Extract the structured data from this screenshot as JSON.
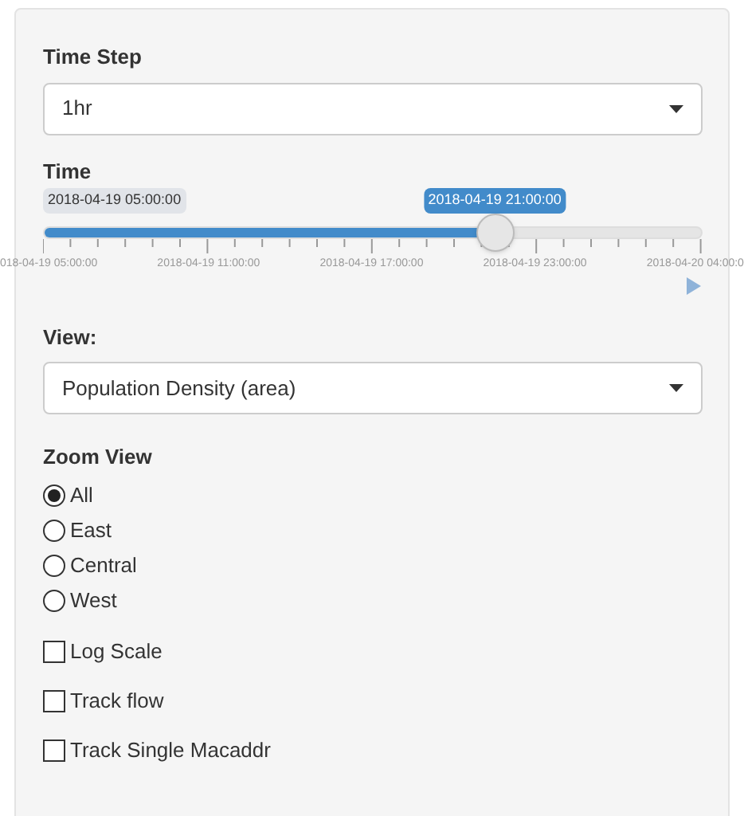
{
  "time_step": {
    "label": "Time Step",
    "value": "1hr"
  },
  "time": {
    "label": "Time",
    "min_label": "2018-04-19 05:00:00",
    "value_label": "2018-04-19 21:00:00",
    "level": 0.685,
    "tick_labels": [
      "018-04-19 05:00:00",
      "2018-04-19 11:00:00",
      "2018-04-19 17:00:00",
      "2018-04-19 23:00:00",
      "2018-04-20 04:00:0"
    ]
  },
  "view": {
    "label": "View:",
    "value": "Population Density (area)"
  },
  "zoom_view": {
    "label": "Zoom View",
    "options": [
      {
        "label": "All",
        "selected": true
      },
      {
        "label": "East",
        "selected": false
      },
      {
        "label": "Central",
        "selected": false
      },
      {
        "label": "West",
        "selected": false
      }
    ]
  },
  "checkboxes": [
    {
      "label": "Log Scale",
      "checked": false
    },
    {
      "label": "Track flow",
      "checked": false
    },
    {
      "label": "Track Single Macaddr",
      "checked": false
    }
  ]
}
